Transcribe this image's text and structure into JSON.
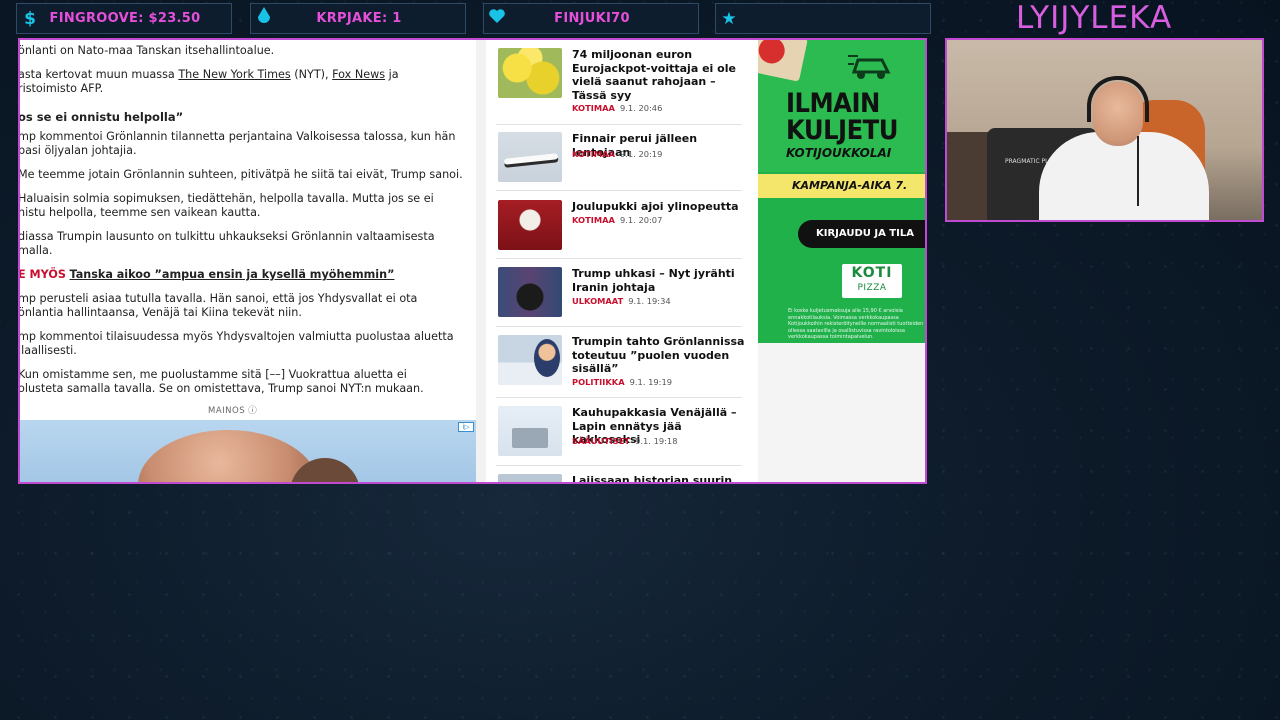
{
  "overlay": {
    "boxes": [
      {
        "icon": "$",
        "label": "FINGROOVE: $23.50"
      },
      {
        "icon": "💧",
        "label": "KRPJAKE: 1"
      },
      {
        "icon": "💙",
        "label": "FINJUKI70"
      },
      {
        "icon": "★",
        "label": ""
      }
    ],
    "streamer_name": "LYIJYLEKA"
  },
  "article": {
    "p1": "önlanti on Nato-maa Tanskan itsehallintoalue.",
    "p2_pre": "asta kertovat muun muassa ",
    "p2_link1": "The New York Times",
    "p2_mid": " (NYT), ",
    "p2_link2": "Fox News",
    "p2_post": " ja",
    "p2b": "ristoimisto AFP.",
    "heading": "os se ei onnistu helpolla”",
    "p3": "mp kommentoi Grönlannin tilannetta perjantaina Valkoisessa talossa, kun hän",
    "p3b": "pasi öljyalan johtajia.",
    "p4": "Me teemme jotain Grönlannin suhteen, pitivätpä he siitä tai eivät, Trump sanoi.",
    "p5": "Haluaisin solmia sopimuksen, tiedättehän, helpolla tavalla. Mutta jos se ei",
    "p5b": "nistu helpolla, teemme sen vaikean kautta.",
    "p6": "diassa Trumpin lausunto on tulkittu uhkaukseksi Grönlannin valtaamisesta",
    "p6b": "malla.",
    "also_label": "E MYÖS",
    "also_link": "Tanska aikoo ”ampua ensin ja kysellä myöhemmin”",
    "p7": "mp perusteli asiaa tutulla tavalla. Hän sanoi, että jos Yhdysvallat ei ota",
    "p7b": "önlantia hallintaansa, Venäjä tai Kiina tekevät niin.",
    "p8": "mp kommentoi tilaisuudessa myös Yhdysvaltojen valmiutta puolustaa aluetta",
    "p8b": "ilaallisesti.",
    "p9": "Kun omistamme sen, me puolustamme sitä [––] Vuokrattua aluetta ei",
    "p9b": "olusteta samalla tavalla. Se on omistettava, Trump sanoi NYT:n mukaan.",
    "ad_label": "MAINOS ⓘ",
    "ad_chip": "i▷"
  },
  "news": [
    {
      "title": "74 miljoonan euron Eurojackpot-voittaja ei ole vielä saanut rahojaan – Tässä syy",
      "category": "KOTIMAA",
      "time": "9.1. 20:46"
    },
    {
      "title": "Finnair perui jälleen lentojaan",
      "category": "KOTIMAA",
      "time": "9.1. 20:19"
    },
    {
      "title": "Joulupukki ajoi ylinopeutta",
      "category": "KOTIMAA",
      "time": "9.1. 20:07"
    },
    {
      "title": "Trump uhkasi – Nyt jyrähti Iranin johtaja",
      "category": "ULKOMAAT",
      "time": "9.1. 19:34"
    },
    {
      "title": "Trumpin tahto Grönlannissa toteutuu ”puolen vuoden sisällä”",
      "category": "POLITIIKKA",
      "time": "9.1. 19:19"
    },
    {
      "title": "Kauhupakkasia Venäjällä – Lapin ennätys jää kakkoseksi",
      "category": "SÄÄUUTISET",
      "time": "9.1. 19:18"
    },
    {
      "title": "Lajissaan historian suurin",
      "category": "",
      "time": ""
    }
  ],
  "right_ad": {
    "headline1": "ILMAIN",
    "headline2": "KULJETU",
    "sub": "KOTIJOUKKOLAI",
    "band": "KAMPANJA-AIKA 7.",
    "cta": "KIRJAUDU JA TILA",
    "logo1": "KOTI",
    "logo2": "PIZZA",
    "fine": "Ei koske kuljetusmaksuja alle 15,90 € arvoisia ennakkotilauksia. Voimassa verkkokaupassa Kotijoukkoihin rekisteröityneille normaalisti tuotteiden ollessa saatavilla ja osallistuvissa ravintoloissa verkkokaupassa toimintapalvelun."
  },
  "webcam": {
    "chair_label": "PRAGMATIC PLAY"
  },
  "colors": {
    "accent": "#c04bd2",
    "overlay_text": "#e64fd9",
    "icon": "#19c3e6",
    "news_category": "#c8102e",
    "ad_green": "#21b14b"
  }
}
